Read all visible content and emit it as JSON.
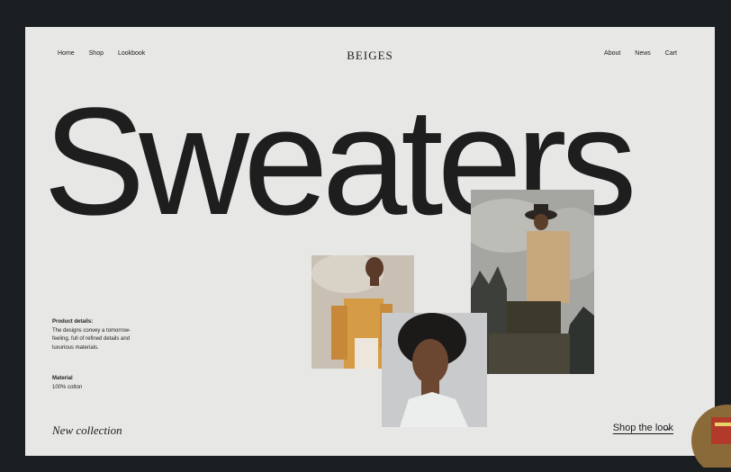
{
  "nav": {
    "left": [
      "Home",
      "Shop",
      "Lookbook"
    ],
    "right": [
      "About",
      "News",
      "Cart"
    ]
  },
  "brand": "BEIGES",
  "hero": {
    "title": "Sweaters"
  },
  "details": {
    "heading": "Product details:",
    "text": "The designs convey a tomorrow-feeling, full of refined details and luxurious materials."
  },
  "material": {
    "heading": "Material",
    "text": "100% cotton"
  },
  "footer": {
    "new_collection": "New collection",
    "shop_cta": "Shop the look",
    "arrow": "→"
  },
  "colors": {
    "page_bg": "#e7e7e6",
    "frame": "#1b1f21",
    "text": "#1e1e1e"
  }
}
